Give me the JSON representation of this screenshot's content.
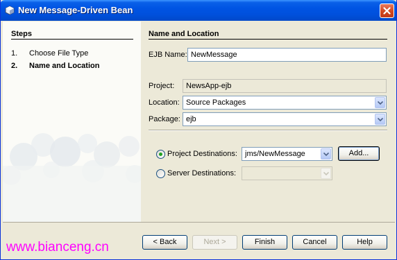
{
  "window": {
    "title": "New Message-Driven Bean"
  },
  "steps": {
    "heading": "Steps",
    "items": [
      {
        "num": "1.",
        "label": "Choose File Type"
      },
      {
        "num": "2.",
        "label": "Name and Location"
      }
    ]
  },
  "panel": {
    "heading": "Name and Location",
    "ejb_name": {
      "label": "EJB Name:",
      "value": "NewMessage"
    },
    "project": {
      "label": "Project:",
      "value": "NewsApp-ejb"
    },
    "location": {
      "label": "Location:",
      "value": "Source Packages"
    },
    "package": {
      "label": "Package:",
      "value": "ejb"
    },
    "project_destinations": {
      "label": "Project Destinations:",
      "value": "jms/NewMessage",
      "selected": true
    },
    "server_destinations": {
      "label": "Server Destinations:",
      "value": "",
      "selected": false
    },
    "add_label": "Add..."
  },
  "buttons": {
    "back": "< Back",
    "next": "Next >",
    "finish": "Finish",
    "cancel": "Cancel",
    "help": "Help"
  },
  "watermark": "www.bianceng.cn",
  "colors": {
    "title_bar": "#0054e3",
    "radio_selected": "#21a121",
    "watermark": "#ff00ff"
  }
}
